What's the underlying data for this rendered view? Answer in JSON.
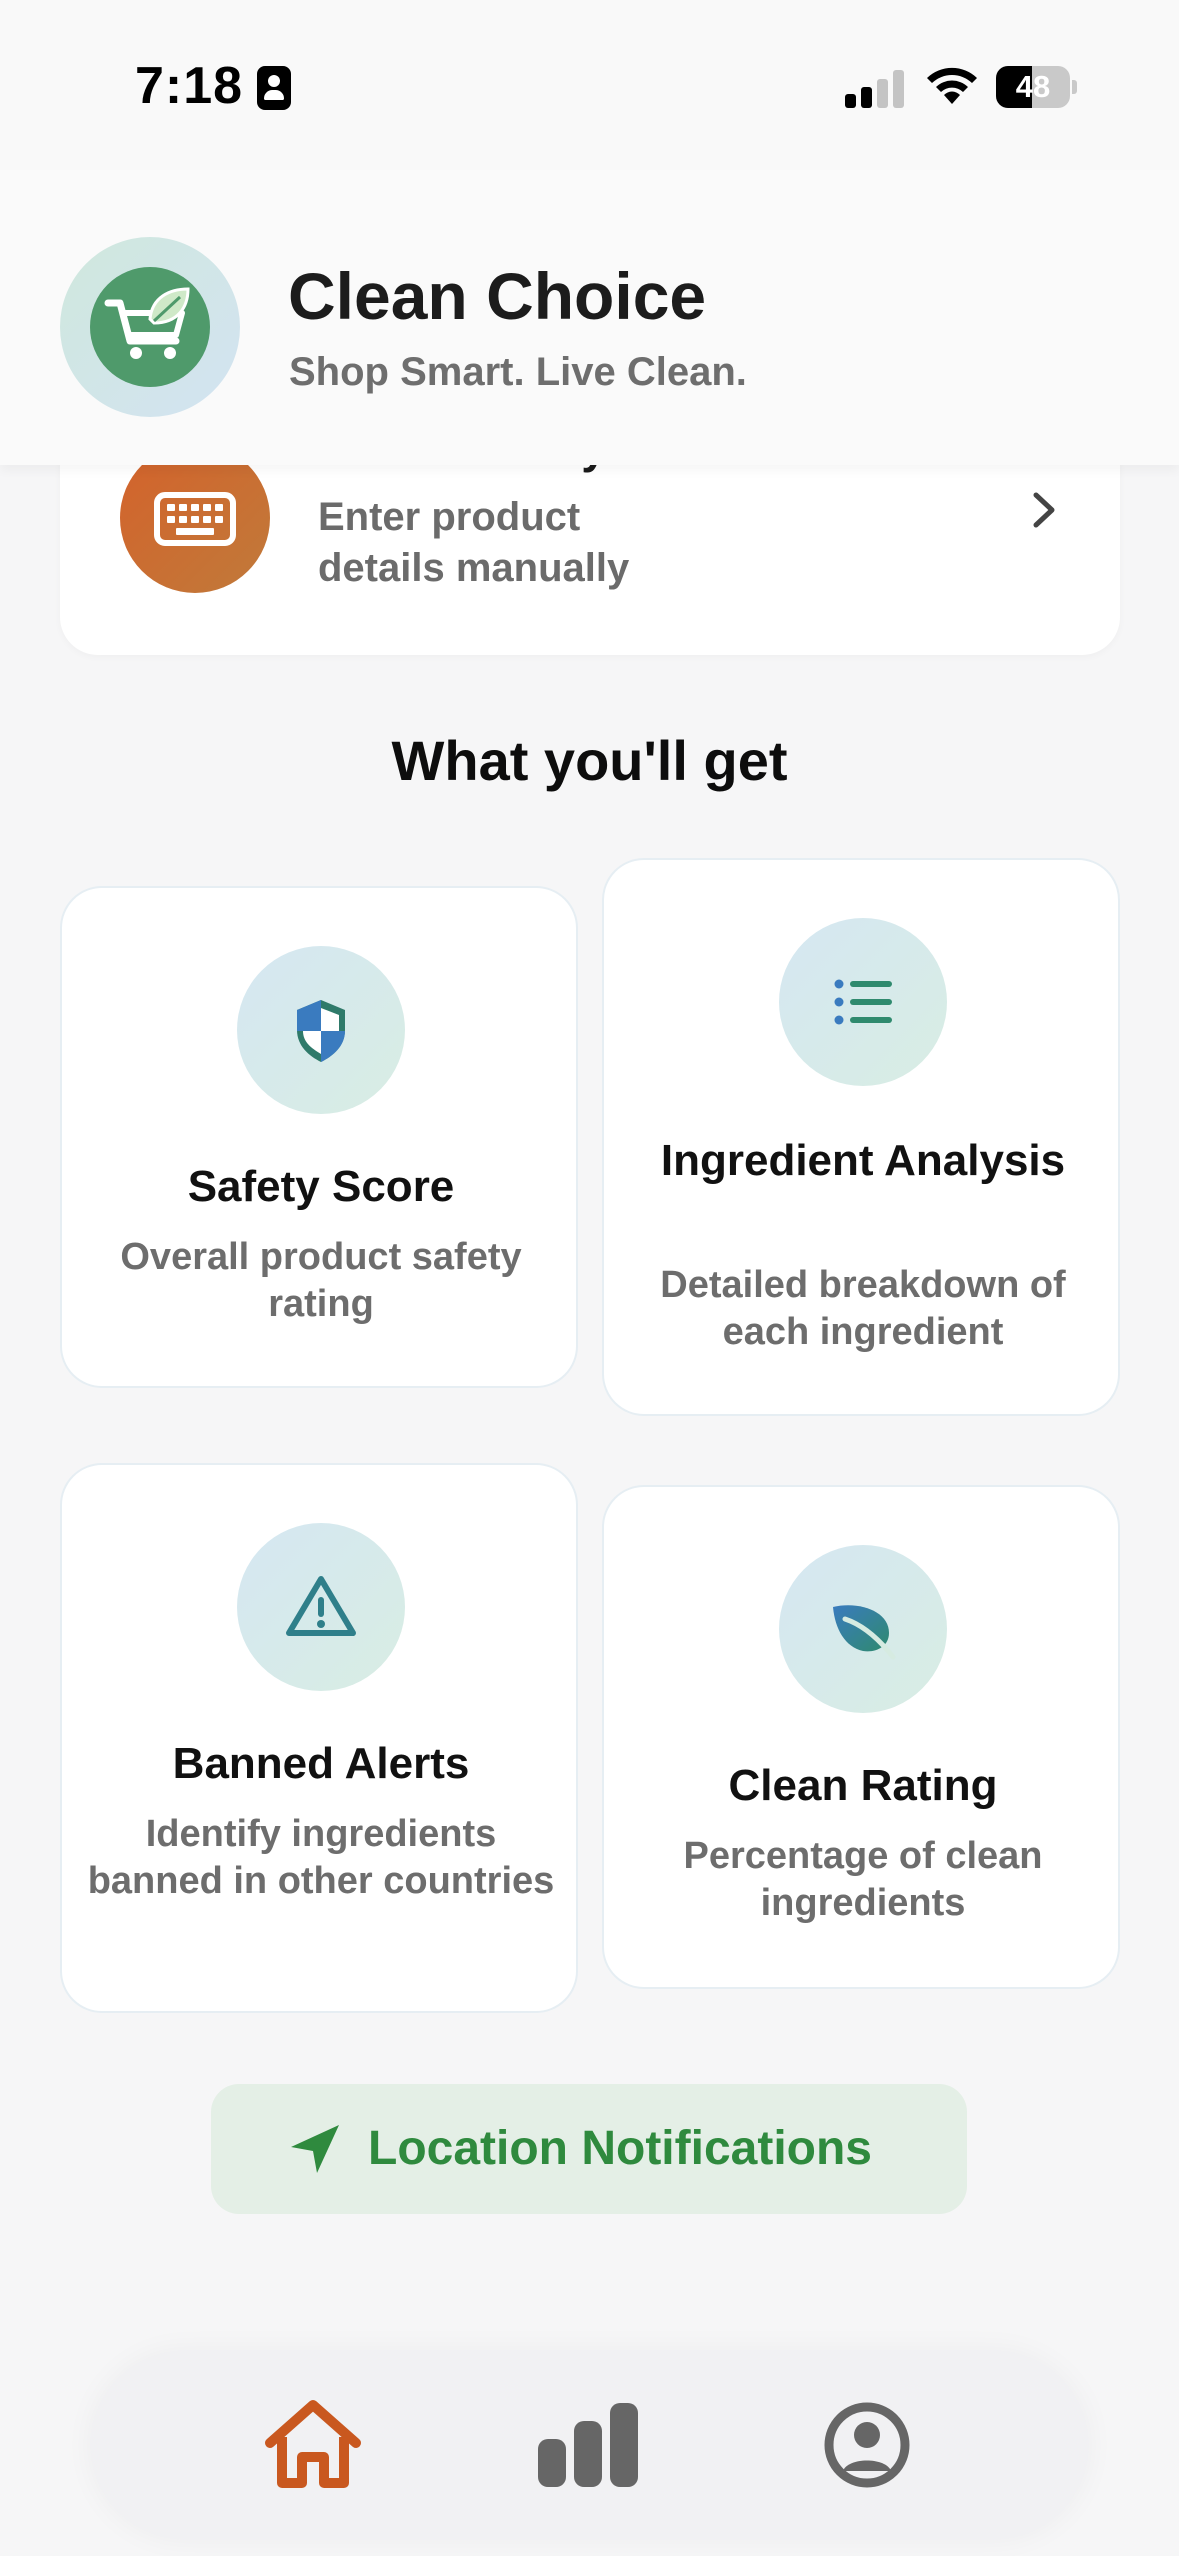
{
  "status_bar": {
    "time": "7:18",
    "battery_level": "48",
    "battery_fraction": 0.48,
    "signal_bars_active": 2,
    "signal_bars_total": 4
  },
  "header": {
    "app_name": "Clean Choice",
    "tagline": "Shop Smart. Live Clean.",
    "logo_icon": "shopping-cart-leaf-icon"
  },
  "manual_entry": {
    "title": "Manual Entry",
    "description": "Enter product details manually",
    "icon": "keyboard-icon"
  },
  "features_section": {
    "title": "What you'll get",
    "cards": [
      {
        "title": "Safety Score",
        "description": "Overall product safety rating",
        "icon": "shield-icon"
      },
      {
        "title": "Ingredient Analysis",
        "description": "Detailed breakdown of each ingredient",
        "icon": "list-icon"
      },
      {
        "title": "Banned Alerts",
        "description": "Identify ingredients banned in other countries",
        "icon": "warning-icon"
      },
      {
        "title": "Clean Rating",
        "description": "Percentage of clean ingredients",
        "icon": "leaf-icon"
      }
    ]
  },
  "location_button": {
    "label": "Location Notifications",
    "icon": "location-arrow-icon"
  },
  "tab_bar": {
    "tabs": [
      {
        "name": "home",
        "icon": "home-icon",
        "active": true
      },
      {
        "name": "stats",
        "icon": "bar-chart-icon",
        "active": false
      },
      {
        "name": "profile",
        "icon": "profile-icon",
        "active": false
      }
    ]
  },
  "colors": {
    "accent_orange": "#c9581f",
    "brand_green": "#4f9a6b",
    "location_green": "#2f8a3e",
    "icon_blue": "#3a7bbf",
    "icon_teal": "#2f8a6e"
  }
}
